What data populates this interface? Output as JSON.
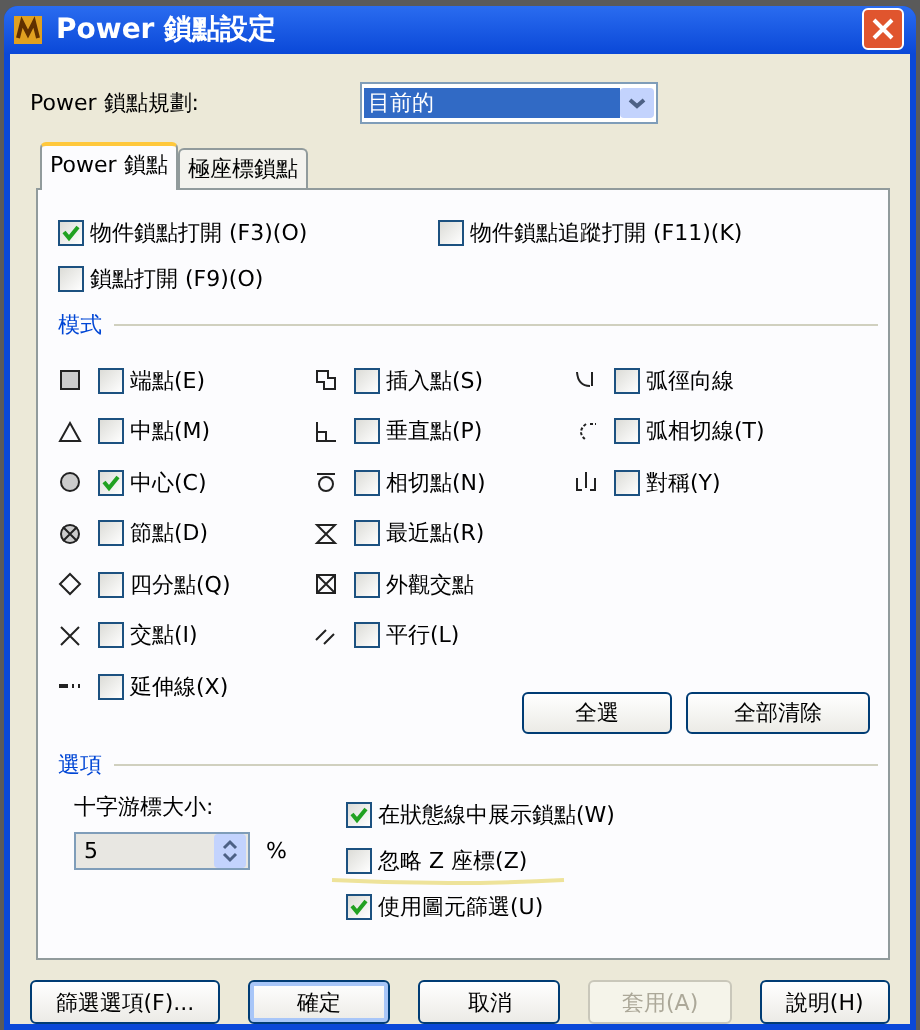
{
  "window": {
    "title": "Power 鎖點設定"
  },
  "profile": {
    "label": "Power 鎖點規劃:",
    "value": "目前的"
  },
  "tabs": [
    {
      "label": "Power 鎖點",
      "selected": true
    },
    {
      "label": "極座標鎖點",
      "selected": false
    }
  ],
  "toggles": [
    {
      "label": "物件鎖點打開 (F3)(O)",
      "checked": true
    },
    {
      "label": "物件鎖點追蹤打開 (F11)(K)",
      "checked": false
    },
    {
      "label": "鎖點打開 (F9)(O)",
      "checked": false
    }
  ],
  "modes": {
    "title": "模式",
    "columns": [
      [
        {
          "label": "端點(E)",
          "checked": false
        },
        {
          "label": "中點(M)",
          "checked": false
        },
        {
          "label": "中心(C)",
          "checked": true
        },
        {
          "label": "節點(D)",
          "checked": false
        },
        {
          "label": "四分點(Q)",
          "checked": false
        },
        {
          "label": "交點(I)",
          "checked": false
        },
        {
          "label": "延伸線(X)",
          "checked": false
        }
      ],
      [
        {
          "label": "插入點(S)",
          "checked": false
        },
        {
          "label": "垂直點(P)",
          "checked": false
        },
        {
          "label": "相切點(N)",
          "checked": false
        },
        {
          "label": "最近點(R)",
          "checked": false
        },
        {
          "label": "外觀交點",
          "checked": false
        },
        {
          "label": "平行(L)",
          "checked": false
        }
      ],
      [
        {
          "label": "弧徑向線",
          "checked": false
        },
        {
          "label": "弧相切線(T)",
          "checked": false
        },
        {
          "label": "對稱(Y)",
          "checked": false
        }
      ]
    ],
    "buttons": [
      "全選",
      "全部清除"
    ]
  },
  "options": {
    "title": "選項",
    "cursor_label": "十字游標大小:",
    "cursor_value": "5",
    "unit": "%",
    "checks": [
      {
        "label": "在狀態線中展示鎖點(W)",
        "checked": true
      },
      {
        "label": "忽略 Z 座標(Z)",
        "checked": false
      },
      {
        "label": "使用圖元篩選(U)",
        "checked": true
      }
    ]
  },
  "buttons": [
    {
      "label": "篩選選項(F)...",
      "disabled": false,
      "default": false
    },
    {
      "label": "確定",
      "disabled": false,
      "default": true
    },
    {
      "label": "取消",
      "disabled": false,
      "default": false
    },
    {
      "label": "套用(A)",
      "disabled": true,
      "default": false
    },
    {
      "label": "說明(H)",
      "disabled": false,
      "default": false
    }
  ]
}
